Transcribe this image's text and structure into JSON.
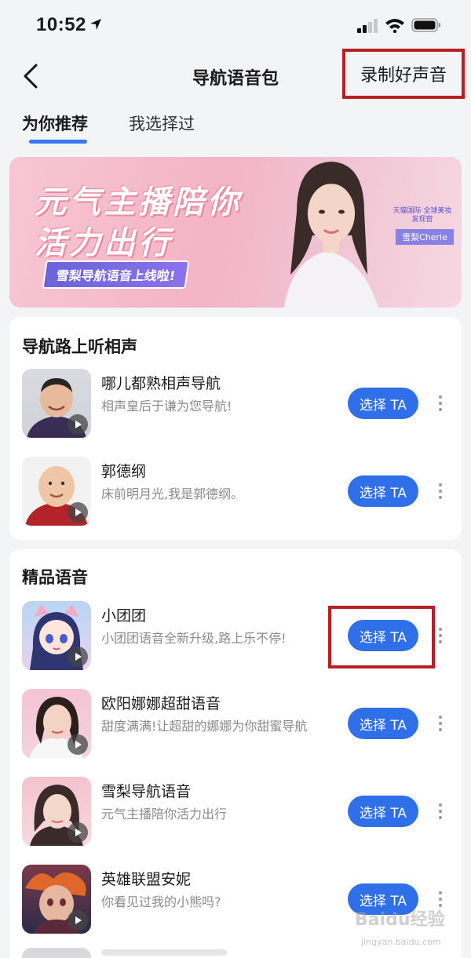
{
  "status_bar": {
    "time": "10:52"
  },
  "nav": {
    "title": "导航语音包",
    "record_label": "录制好声音"
  },
  "tabs": [
    {
      "label": "为你推荐",
      "active": true
    },
    {
      "label": "我选择过",
      "active": false
    }
  ],
  "banner": {
    "title_line1": "元气主播陪你",
    "title_line2": "活力出行",
    "tag": "雪梨导航语音上线啦!",
    "badge_subtitle": "天猫国际 全球美妆发现官",
    "badge_name": "雪梨Cherie"
  },
  "sections": [
    {
      "title": "导航路上听相声",
      "items": [
        {
          "name": "哪儿都熟相声导航",
          "desc": "相声皇后于谦为您导航!",
          "button": "选择 TA"
        },
        {
          "name": "郭德纲",
          "desc": "床前明月光,我是郭德纲。",
          "button": "选择 TA"
        }
      ]
    },
    {
      "title": "精品语音",
      "items": [
        {
          "name": "小团团",
          "desc": "小团团语音全新升级,路上乐不停!",
          "button": "选择 TA"
        },
        {
          "name": "欧阳娜娜超甜语音",
          "desc": "甜度满满!让超甜的娜娜为你甜蜜导航",
          "button": "选择 TA"
        },
        {
          "name": "雪梨导航语音",
          "desc": "元气主播陪你活力出行",
          "button": "选择 TA"
        },
        {
          "name": "英雄联盟安妮",
          "desc": "你看见过我的小熊吗?",
          "button": "选择 TA"
        }
      ]
    }
  ],
  "watermark": {
    "text": "Baidu经验",
    "url": "jingyan.baidu.com"
  },
  "colors": {
    "accent": "#2f6fe8",
    "highlight": "#b62025",
    "background": "#f3f4f6"
  }
}
